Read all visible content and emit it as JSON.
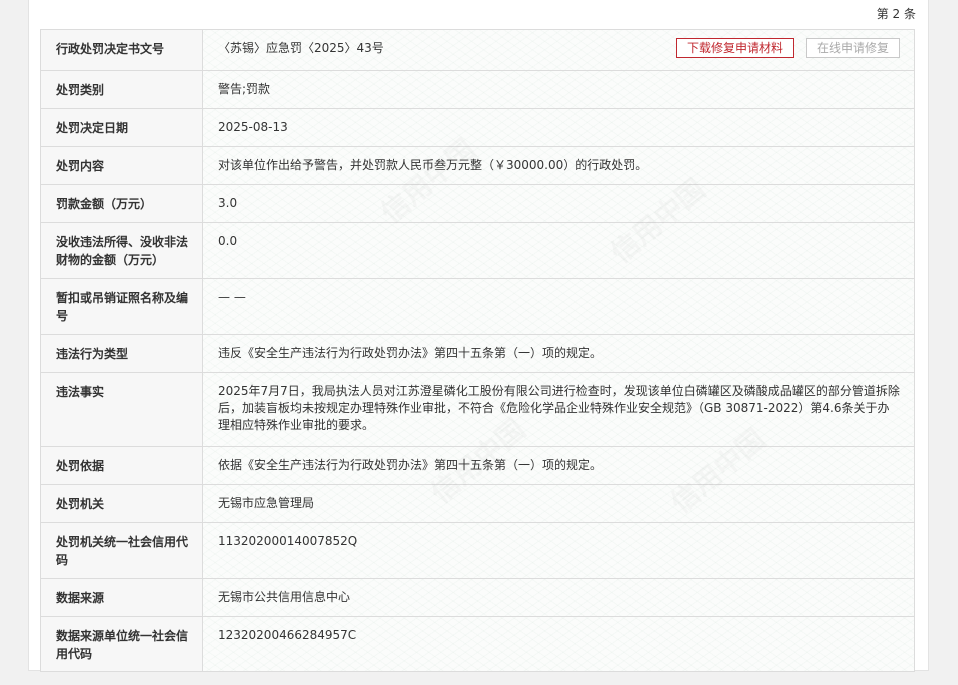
{
  "header": {
    "count_text": "第 2 条"
  },
  "actions": {
    "download_label": "下载修复申请材料",
    "online_repair_label": "在线申请修复"
  },
  "rows": [
    {
      "label": "行政处罚决定书文号",
      "value": "〈苏锡〉应急罚〈2025〉43号"
    },
    {
      "label": "处罚类别",
      "value": "警告;罚款"
    },
    {
      "label": "处罚决定日期",
      "value": "2025-08-13"
    },
    {
      "label": "处罚内容",
      "value": "对该单位作出给予警告，并处罚款人民币叁万元整（￥30000.00）的行政处罚。"
    },
    {
      "label": "罚款金额（万元）",
      "value": "3.0"
    },
    {
      "label": "没收违法所得、没收非法财物的金额（万元）",
      "value": "0.0"
    },
    {
      "label": "暂扣或吊销证照名称及编号",
      "value": "— —"
    },
    {
      "label": "违法行为类型",
      "value": "违反《安全生产违法行为行政处罚办法》第四十五条第（一）项的规定。"
    },
    {
      "label": "违法事实",
      "value": "2025年7月7日，我局执法人员对江苏澄星磷化工股份有限公司进行检查时，发现该单位白磷罐区及磷酸成品罐区的部分管道拆除后，加装盲板均未按规定办理特殊作业审批，不符合《危险化学品企业特殊作业安全规范》（GB 30871-2022）第4.6条关于办理相应特殊作业审批的要求。"
    },
    {
      "label": "处罚依据",
      "value": "依据《安全生产违法行为行政处罚办法》第四十五条第（一）项的规定。"
    },
    {
      "label": "处罚机关",
      "value": "无锡市应急管理局"
    },
    {
      "label": "处罚机关统一社会信用代码",
      "value": "11320200014007852Q"
    },
    {
      "label": "数据来源",
      "value": "无锡市公共信用信息中心"
    },
    {
      "label": "数据来源单位统一社会信用代码",
      "value": "12320200466284957C"
    }
  ],
  "watermark": {
    "text": "信用中国"
  }
}
